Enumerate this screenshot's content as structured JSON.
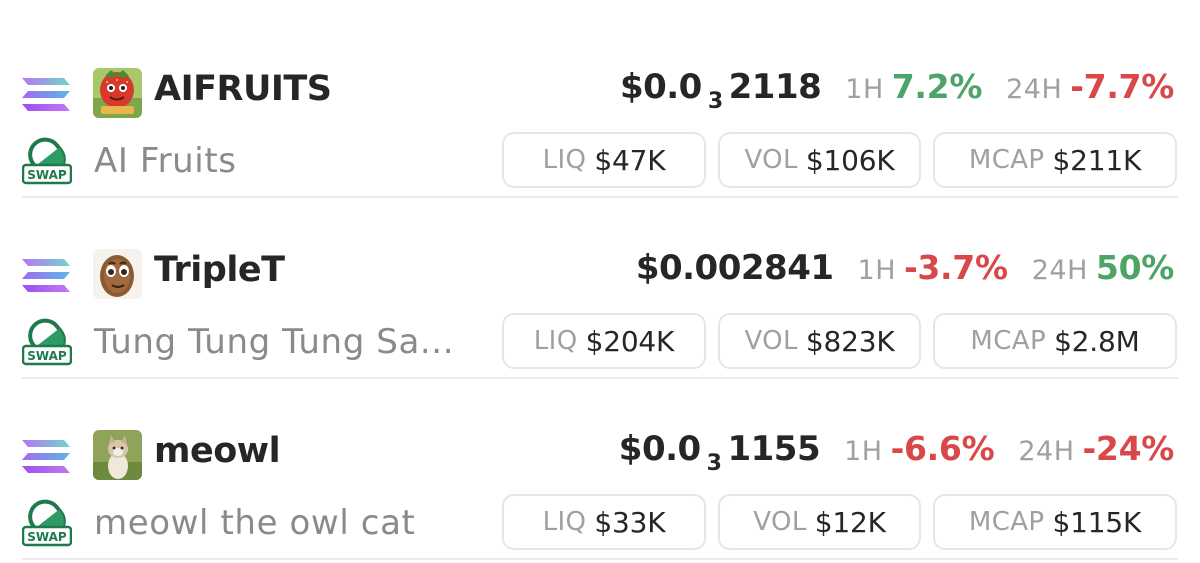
{
  "icons": {
    "chain": "solana-icon",
    "dex": "swap-icon",
    "dex_text": "SWAP"
  },
  "colors": {
    "positive": "#4ea466",
    "negative": "#d94848",
    "muted": "#a0a0a0",
    "text": "#262626"
  },
  "tokens": [
    {
      "symbol": "AIFRUITS",
      "name": "AI Fruits",
      "avatar": "strawberry-character-avatar",
      "price_prefix": "$0.0",
      "price_zero_count": "3",
      "price_digits": "2118",
      "h1_label": "1H",
      "h1_change": "7.2%",
      "h1_direction": "up",
      "h24_label": "24H",
      "h24_change": "-7.7%",
      "h24_direction": "down",
      "liq_label": "LIQ",
      "liq_value": "$47K",
      "vol_label": "VOL",
      "vol_value": "$106K",
      "mcap_label": "MCAP",
      "mcap_value": "$211K"
    },
    {
      "symbol": "TripleT",
      "name": "Tung Tung Tung Sa...",
      "avatar": "wooden-figure-avatar",
      "price": "$0.002841",
      "h1_label": "1H",
      "h1_change": "-3.7%",
      "h1_direction": "down",
      "h24_label": "24H",
      "h24_change": "50%",
      "h24_direction": "up",
      "liq_label": "LIQ",
      "liq_value": "$204K",
      "vol_label": "VOL",
      "vol_value": "$823K",
      "mcap_label": "MCAP",
      "mcap_value": "$2.8M"
    },
    {
      "symbol": "meowl",
      "name": "meowl the owl cat",
      "avatar": "cat-avatar",
      "price_prefix": "$0.0",
      "price_zero_count": "3",
      "price_digits": "1155",
      "h1_label": "1H",
      "h1_change": "-6.6%",
      "h1_direction": "down",
      "h24_label": "24H",
      "h24_change": "-24%",
      "h24_direction": "down",
      "liq_label": "LIQ",
      "liq_value": "$33K",
      "vol_label": "VOL",
      "vol_value": "$12K",
      "mcap_label": "MCAP",
      "mcap_value": "$115K"
    }
  ]
}
